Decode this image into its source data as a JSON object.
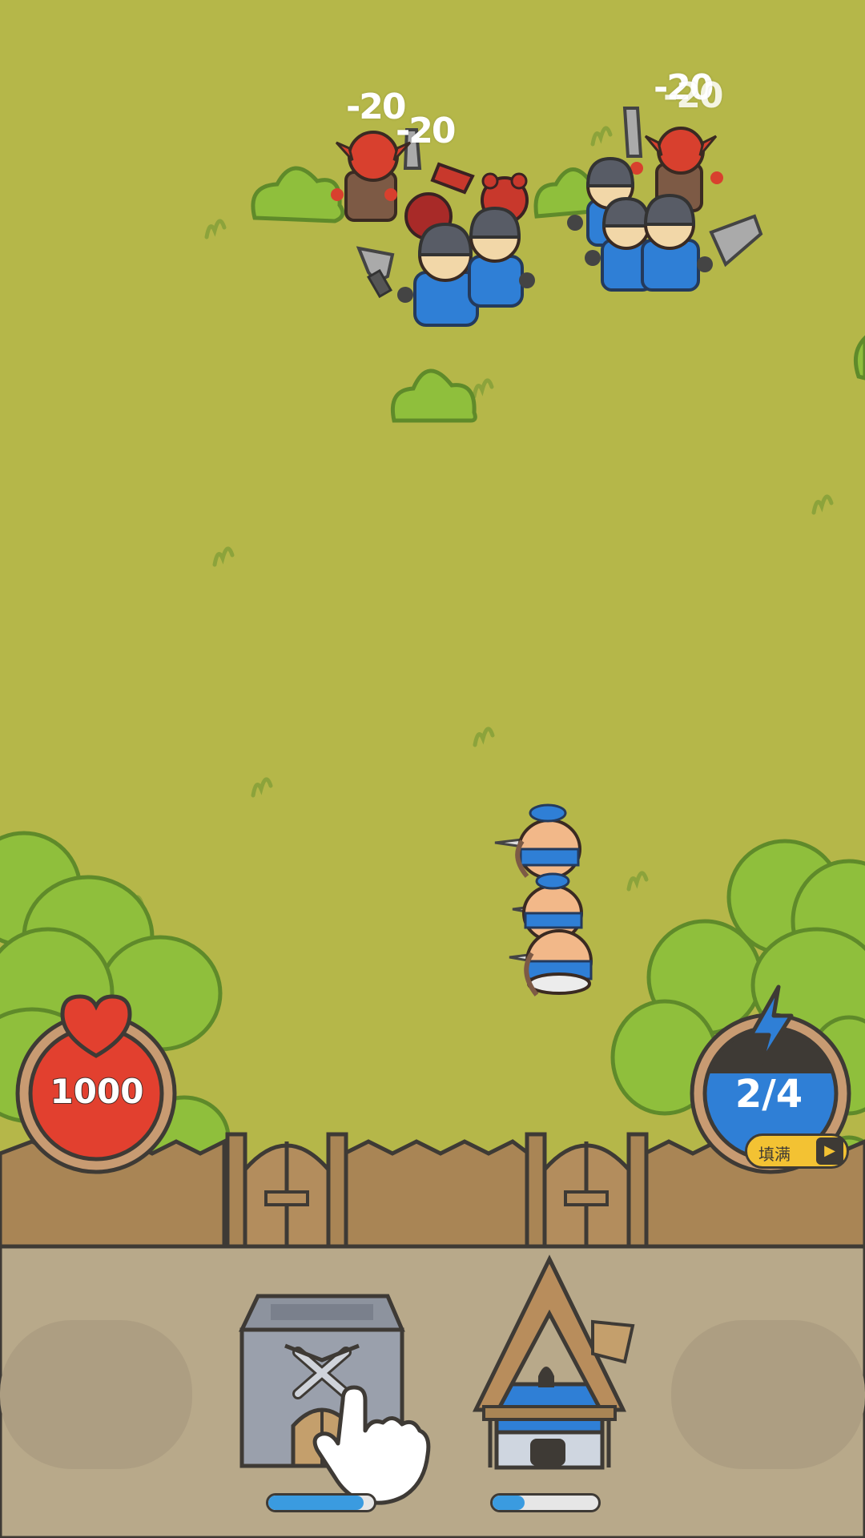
{
  "damage_popups": [
    "-20",
    "-20",
    "-20",
    "-20"
  ],
  "hud": {
    "lives": "1000",
    "lives_icon": "heart-icon",
    "energy": "2/4",
    "energy_icon": "lightning-icon",
    "fill_button_label": "填满",
    "fill_button_icon": "video-ad-icon"
  },
  "build_tray": {
    "barracks_progress": 0.9,
    "archer_house_progress": 0.3
  },
  "colors": {
    "grass": "#b5b749",
    "grass_edge": "#8f9a37",
    "bush": "#8fbf3c",
    "fence": "#a98555",
    "tray": "#b8a98a",
    "ally_blue": "#2f7fd6",
    "enemy_red": "#d8402e",
    "progress_blue": "#3a9be0"
  }
}
